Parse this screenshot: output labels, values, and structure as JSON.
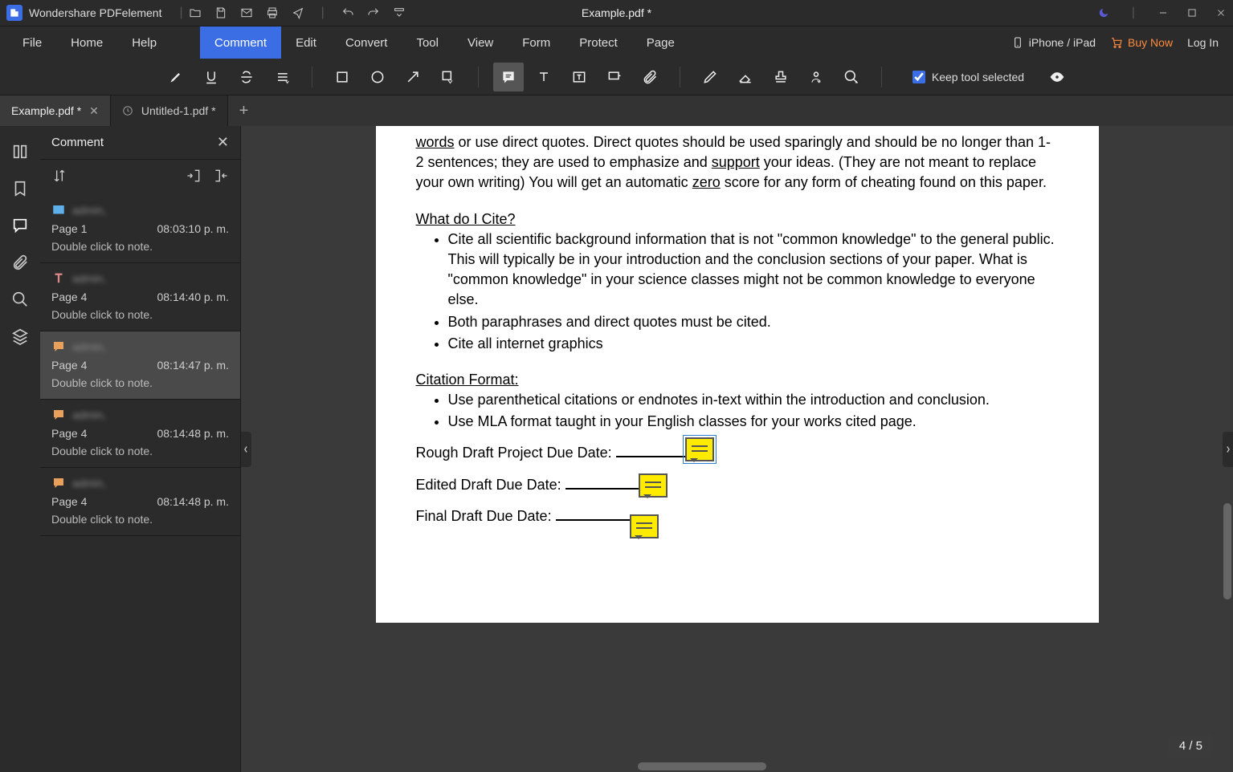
{
  "app": {
    "name": "Wondershare PDFelement",
    "document_title": "Example.pdf *"
  },
  "menubar": {
    "file": "File",
    "home": "Home",
    "help": "Help",
    "comment": "Comment",
    "edit": "Edit",
    "convert": "Convert",
    "tool": "Tool",
    "view": "View",
    "form": "Form",
    "protect": "Protect",
    "page": "Page",
    "iphone": "iPhone / iPad",
    "buy": "Buy Now",
    "login": "Log In"
  },
  "toolbar": {
    "keep_label": "Keep tool selected",
    "keep_checked": true
  },
  "tabs": [
    {
      "label": "Example.pdf *",
      "active": true
    },
    {
      "label": "Untitled-1.pdf *",
      "active": false
    }
  ],
  "panel": {
    "title": "Comment",
    "note_hint": "Double click to note.",
    "items": [
      {
        "icon": "highlight",
        "author": "admin,",
        "page": "Page 1",
        "time": "08:03:10 p. m.",
        "selected": false
      },
      {
        "icon": "text",
        "author": "admin,",
        "page": "Page 4",
        "time": "08:14:40 p. m.",
        "selected": false
      },
      {
        "icon": "note",
        "author": "admin,",
        "page": "Page 4",
        "time": "08:14:47 p. m.",
        "selected": true
      },
      {
        "icon": "note",
        "author": "admin,",
        "page": "Page 4",
        "time": "08:14:48 p. m.",
        "selected": false
      },
      {
        "icon": "note",
        "author": "admin,",
        "page": "Page 4",
        "time": "08:14:48 p. m.",
        "selected": false
      }
    ]
  },
  "doc": {
    "frag_words": "words",
    "frag1": " or use direct quotes.   Direct quotes should be used sparingly and should be no longer than 1-2 sentences; they are used to emphasize and ",
    "frag_support": "support",
    "frag2": " your ideas.  (They are not meant to replace your own writing) You will get an automatic ",
    "frag_zero": "zero",
    "frag3": " score for any form of cheating found on this paper.",
    "heading1": "What do I Cite?",
    "b1": "Cite all scientific background information that is not \"common knowledge\" to the general public.  This will typically be in your introduction and the conclusion sections of your paper. What is \"common knowledge\" in your science classes might not be common knowledge to everyone else.",
    "b2": "Both paraphrases and direct quotes must be cited.",
    "b3": "Cite all internet graphics",
    "heading2": "Citation Format:",
    "c1": "Use parenthetical citations or endnotes in-text within the introduction and conclusion.",
    "c2": "Use MLA format taught in your English classes for your works cited page.",
    "rough": "Rough Draft Project Due Date: ",
    "edited": "Edited Draft Due Date: ",
    "final": "Final Draft Due Date: "
  },
  "pagecount": "4 / 5"
}
